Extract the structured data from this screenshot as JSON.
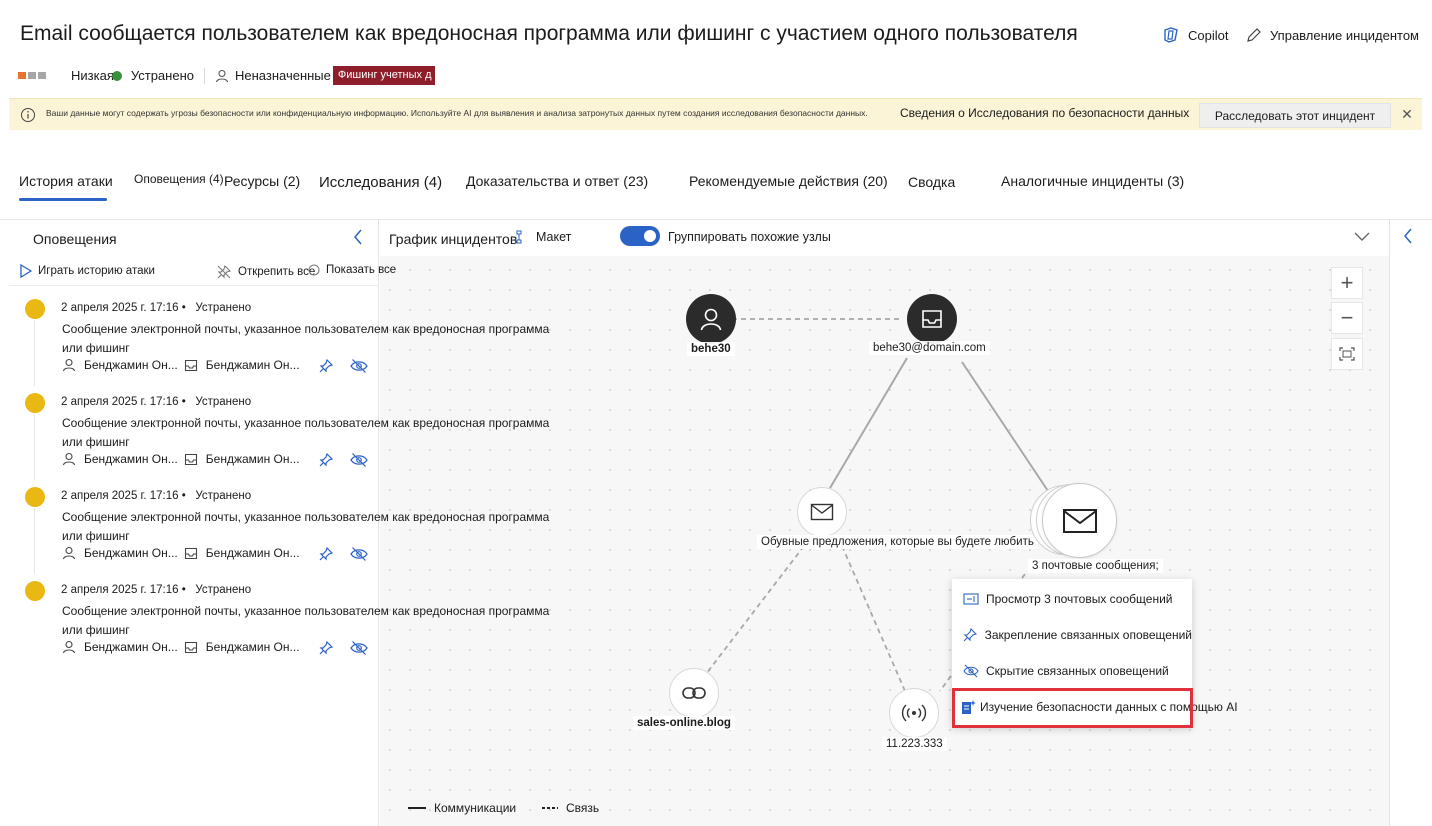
{
  "header": {
    "title": "Email сообщается пользователем как вредоносная программа или фишинг с участием одного пользователя",
    "copilot_label": "Copilot",
    "manage_label": "Управление инцидентом"
  },
  "meta": {
    "severity": "Низкая",
    "status": "Устранено",
    "assignee": "Неназначенные",
    "tag": "Фишинг учетных д",
    "colors": {
      "severity": "#e8732c",
      "status": "#3a8f3a",
      "tag": "#8e1f2a"
    }
  },
  "banner": {
    "text": "Ваши данные могут содержать угрозы безопасности или конфиденциальную информацию. Используйте AI для выявления и анализа затронутых данных путем создания исследования безопасности данных.",
    "link": "Сведения о Исследования по безопасности данных",
    "button": "Расследовать этот инцидент"
  },
  "tabs": [
    {
      "label": "История атаки"
    },
    {
      "label": "Оповещения (4)"
    },
    {
      "label": "Ресурсы (2)"
    },
    {
      "label": "Исследования (4)"
    },
    {
      "label": "Доказательства и ответ (23)"
    },
    {
      "label": "Рекомендуемые действия (20)"
    },
    {
      "label": "Сводка"
    },
    {
      "label": "Аналогичные инциденты (3)"
    }
  ],
  "alerts_panel": {
    "title": "Оповещения",
    "play_label": "Играть историю атаки",
    "unpin_label": "Открепить все",
    "show_label": "Показать все",
    "items": [
      {
        "date": "2 апреля 2025 г. 17:16 •",
        "status": "Устранено",
        "desc": "Сообщение электронной почты, указанное пользователем как вредоносная программа или фишинг",
        "user": "Бенджамин Он...",
        "mailbox": "Бенджамин Он..."
      },
      {
        "date": "2 апреля 2025 г. 17:16 •",
        "status": "Устранено",
        "desc": "Сообщение электронной почты, указанное пользователем как вредоносная программа или фишинг",
        "user": "Бенджамин Он...",
        "mailbox": "Бенджамин Он..."
      },
      {
        "date": "2 апреля 2025 г. 17:16 •",
        "status": "Устранено",
        "desc": "Сообщение электронной почты, указанное пользователем как вредоносная программа или фишинг",
        "user": "Бенджамин Он...",
        "mailbox": "Бенджамин Он..."
      },
      {
        "date": "2 апреля 2025 г. 17:16 •",
        "status": "Устранено",
        "desc": "Сообщение электронной почты, указанное пользователем как вредоносная программа или фишинг",
        "user": "Бенджамин Он...",
        "mailbox": "Бенджамин Он..."
      }
    ]
  },
  "graph": {
    "title": "График инцидентов",
    "layout_label": "Макет",
    "group_label": "Группировать похожие узлы",
    "zoom_in": "+",
    "zoom_out": "−",
    "nodes": {
      "user": "behe30",
      "mailbox": "behe30@domain.com",
      "email": "Обувные предложения, которые вы будете любить",
      "email_group": "3  почтовые сообщения;",
      "url": "sales-online.blog",
      "ip": "11.223.333"
    },
    "legend": {
      "solid": "Коммуникации",
      "dashed": "Связь"
    }
  },
  "context_menu": {
    "items": [
      {
        "label": "Просмотр 3 почтовых сообщений",
        "icon": "view-list-icon"
      },
      {
        "label": "Закрепление связанных оповещений",
        "icon": "pin-icon"
      },
      {
        "label": "Скрытие связанных оповещений",
        "icon": "hide-icon"
      },
      {
        "label": "Изучение безопасности данных с помощью AI",
        "icon": "ai-investigate-icon"
      }
    ],
    "highlight_color": "#e0303a"
  }
}
